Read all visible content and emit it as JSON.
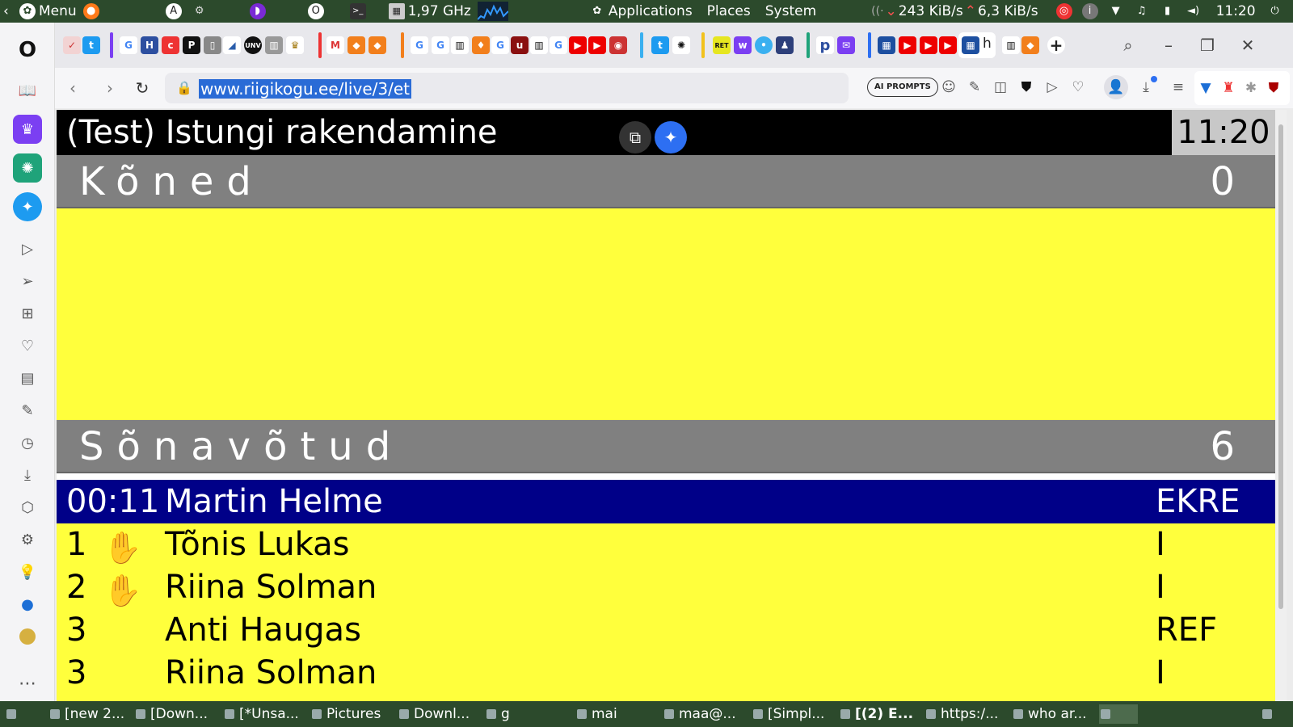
{
  "system_panel": {
    "menu_label": "Menu",
    "cpu_freq": "1,97 GHz",
    "applications_label": "Applications",
    "places_label": "Places",
    "system_label": "System",
    "net_down": "243 KiB/s",
    "net_up": "6,3 KiB/s",
    "clock": "11:20"
  },
  "browser": {
    "url": "www.riigikogu.ee/live/3/et",
    "ai_prompts_label": "AI PROMPTS"
  },
  "page": {
    "session_title": "(Test) Istungi rakendamine",
    "clock": "11:20",
    "speeches": {
      "label": "Kõned",
      "count": "0"
    },
    "requests": {
      "label": "Sõnavõtud",
      "count": "6"
    },
    "current_speaker": {
      "time": "00:11",
      "name": "Martin Helme",
      "party": "EKRE"
    },
    "queue": [
      {
        "num": "1",
        "hand": true,
        "name": "Tõnis Lukas",
        "party": "I"
      },
      {
        "num": "2",
        "hand": true,
        "name": "Riina Solman",
        "party": "I"
      },
      {
        "num": "3",
        "hand": false,
        "name": "Anti Haugas",
        "party": "REF"
      },
      {
        "num": "3",
        "hand": false,
        "name": "Riina Solman",
        "party": "I"
      }
    ]
  },
  "taskbar": {
    "items": [
      "[new 2...",
      "[Down...",
      "[*Unsa...",
      "Pictures",
      "Downl...",
      "g",
      "mai",
      "maa@...",
      "[Simpl...",
      "[(2) E...",
      "https:/...",
      "who ar..."
    ]
  }
}
